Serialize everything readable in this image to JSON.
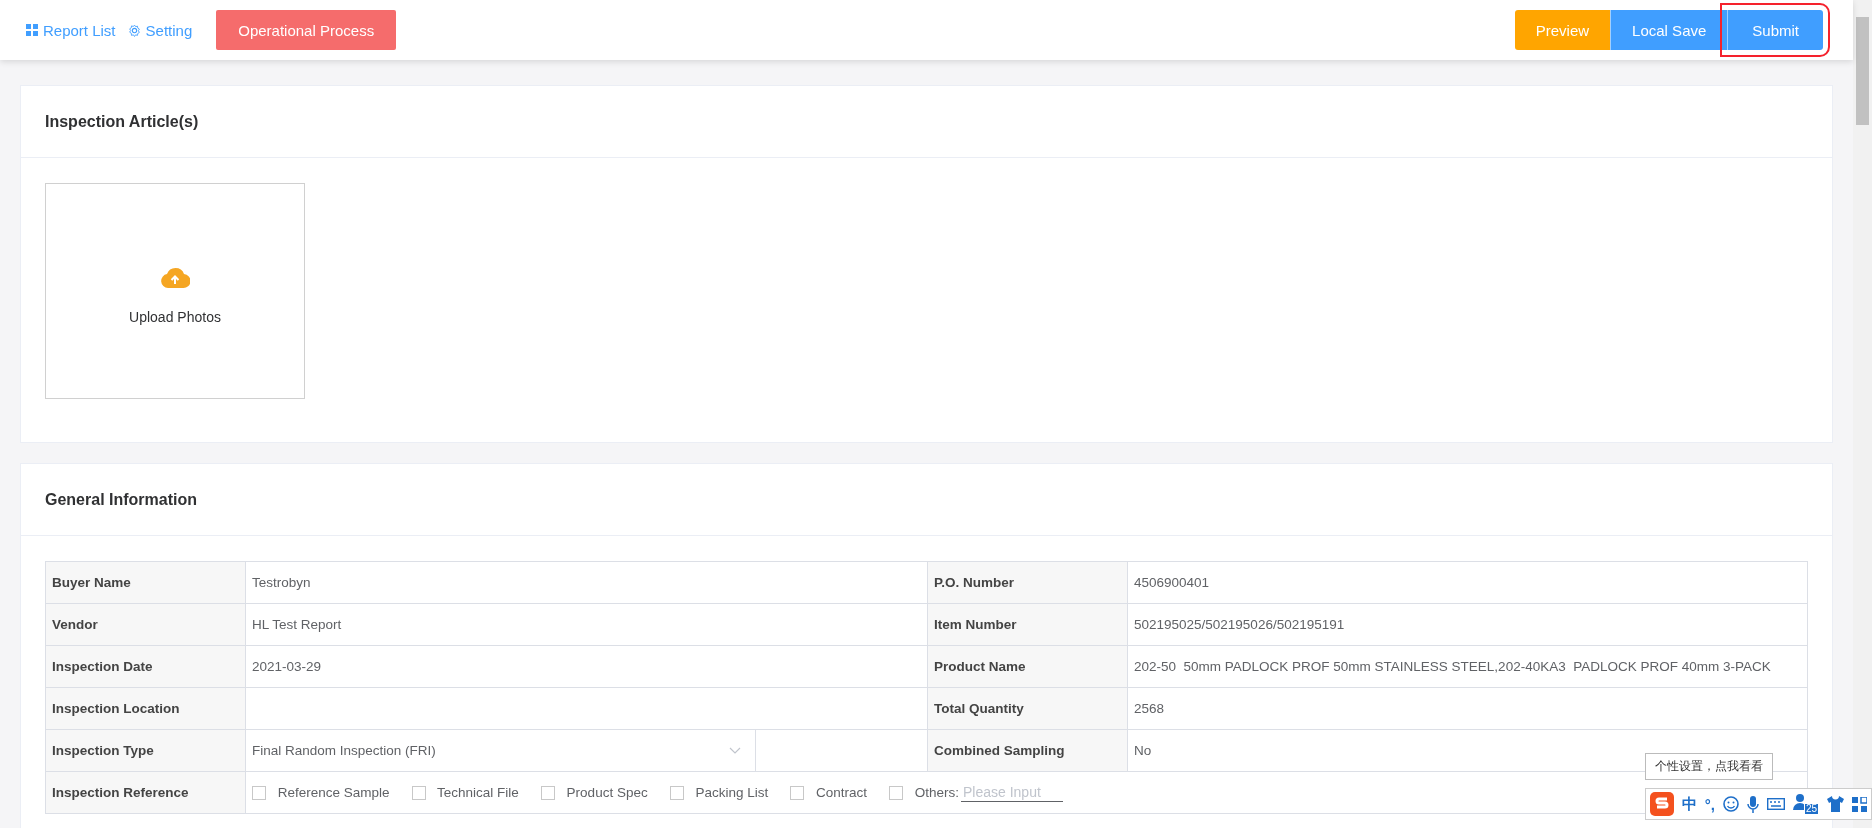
{
  "top_bar": {
    "links": [
      {
        "label": "Report List"
      },
      {
        "label": "Setting"
      }
    ],
    "process_button": "Operational Process",
    "actions": [
      {
        "label": "Preview",
        "kind": "warning",
        "highlighted": false
      },
      {
        "label": "Local Save",
        "kind": "primary",
        "highlighted": false
      },
      {
        "label": "Submit",
        "kind": "primary",
        "highlighted": true
      }
    ]
  },
  "articles": {
    "title": "Inspection Article(s)",
    "upload_label": "Upload Photos"
  },
  "general": {
    "title": "General Information",
    "rows": [
      {
        "kind": "text",
        "label": "Buyer Name",
        "value": "Testrobyn",
        "label_2": "P.O. Number",
        "value_2": "4506900401"
      },
      {
        "kind": "text",
        "label": "Vendor",
        "value": "HL Test Report",
        "label_2": "Item Number",
        "value_2": "502195025/502195026/502195191"
      },
      {
        "kind": "text",
        "label": "Inspection Date",
        "value": "2021-03-29",
        "label_2": "Product Name",
        "value_2": "202-50  50mm PADLOCK PROF 50mm STAINLESS STEEL,202-40KA3  PADLOCK PROF 40mm 3-PACK"
      },
      {
        "kind": "text",
        "label": "Inspection Location",
        "value": "",
        "label_2": "Total Quantity",
        "value_2": "2568"
      },
      {
        "kind": "select",
        "label": "Inspection Type",
        "value": "Final Random Inspection (FRI)",
        "label_2": "Combined Sampling",
        "value_2": "No"
      },
      {
        "kind": "checks",
        "label": "Inspection Reference",
        "options": [
          {
            "label": "Reference Sample",
            "checked": false
          },
          {
            "label": "Technical File",
            "checked": false
          },
          {
            "label": "Product Spec",
            "checked": false
          },
          {
            "label": "Packing List",
            "checked": false
          },
          {
            "label": "Contract",
            "checked": false
          },
          {
            "label": "Others:",
            "checked": false
          }
        ],
        "others_placeholder": "Please Input"
      }
    ]
  },
  "ime_toolbar": {
    "tooltip": "个性设置，点我看看",
    "mode": "中",
    "punctuation": "°,",
    "badge": "25"
  }
}
